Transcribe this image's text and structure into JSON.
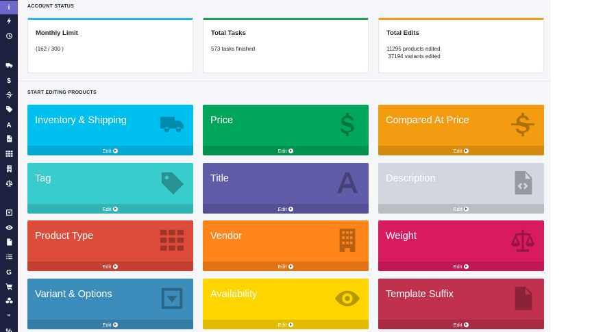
{
  "sidebar": {
    "items": [
      {
        "glyph": "i",
        "icon": "info-icon",
        "active": true
      },
      {
        "glyph": "",
        "icon": "bolt-icon"
      },
      {
        "glyph": "",
        "icon": "clock-icon"
      },
      {
        "glyph": "",
        "icon": "truck-icon"
      },
      {
        "glyph": "$",
        "icon": "dollar-icon"
      },
      {
        "glyph": "",
        "icon": "strikethrough-dollar-icon"
      },
      {
        "glyph": "",
        "icon": "tag-icon"
      },
      {
        "glyph": "A",
        "icon": "font-icon"
      },
      {
        "glyph": "",
        "icon": "file-code-icon"
      },
      {
        "glyph": "",
        "icon": "grid-icon"
      },
      {
        "glyph": "",
        "icon": "building-icon"
      },
      {
        "glyph": "",
        "icon": "balance-scale-icon"
      },
      {
        "glyph": "",
        "icon": "caret-square-icon"
      },
      {
        "glyph": "",
        "icon": "eye-icon"
      },
      {
        "glyph": "",
        "icon": "file-text-icon"
      },
      {
        "glyph": "",
        "icon": "list-icon"
      },
      {
        "glyph": "G",
        "icon": "google-icon"
      },
      {
        "glyph": "",
        "icon": "cart-icon"
      },
      {
        "glyph": "",
        "icon": "cubes-icon"
      },
      {
        "glyph": "“",
        "icon": "quote-icon"
      },
      {
        "glyph": "%",
        "icon": "percent-icon"
      }
    ]
  },
  "account_status": {
    "heading": "ACCOUNT STATUS",
    "cards": [
      {
        "title": "Monthly Limit",
        "lines": [
          "(162 / 300 )"
        ],
        "color": "#2bb4ef"
      },
      {
        "title": "Total Tasks",
        "lines": [
          "573 tasks finished"
        ],
        "color": "#1f9d55"
      },
      {
        "title": "Total Edits",
        "lines": [
          "11295 products edited",
          " 37194 variants edited"
        ],
        "color": "#f39c12"
      }
    ]
  },
  "editing": {
    "heading": "START EDITING PRODUCTS",
    "edit_label": "Edit",
    "tiles": [
      {
        "title": "Inventory & Shipping",
        "color": "#00c0ef",
        "icon": "truck-icon"
      },
      {
        "title": "Price",
        "color": "#00a65a",
        "icon": "dollar-icon"
      },
      {
        "title": "Compared At Price",
        "color": "#f39c12",
        "icon": "strikethrough-dollar-icon"
      },
      {
        "title": "Tag",
        "color": "#39cccc",
        "icon": "tag-icon"
      },
      {
        "title": "Title",
        "color": "#605ca8",
        "icon": "font-icon"
      },
      {
        "title": "Description",
        "color": "#d2d6de",
        "icon": "file-code-icon"
      },
      {
        "title": "Product Type",
        "color": "#dd4b39",
        "icon": "grid-icon"
      },
      {
        "title": "Vendor",
        "color": "#ff851b",
        "icon": "building-icon"
      },
      {
        "title": "Weight",
        "color": "#d81b60",
        "icon": "balance-scale-icon"
      },
      {
        "title": "Variant & Options",
        "color": "#3c8dbc",
        "icon": "caret-square-icon"
      },
      {
        "title": "Availability",
        "color": "#ffd500",
        "icon": "eye-icon"
      },
      {
        "title": "Template Suffix",
        "color": "#c0314d",
        "icon": "file-text-icon"
      }
    ]
  }
}
